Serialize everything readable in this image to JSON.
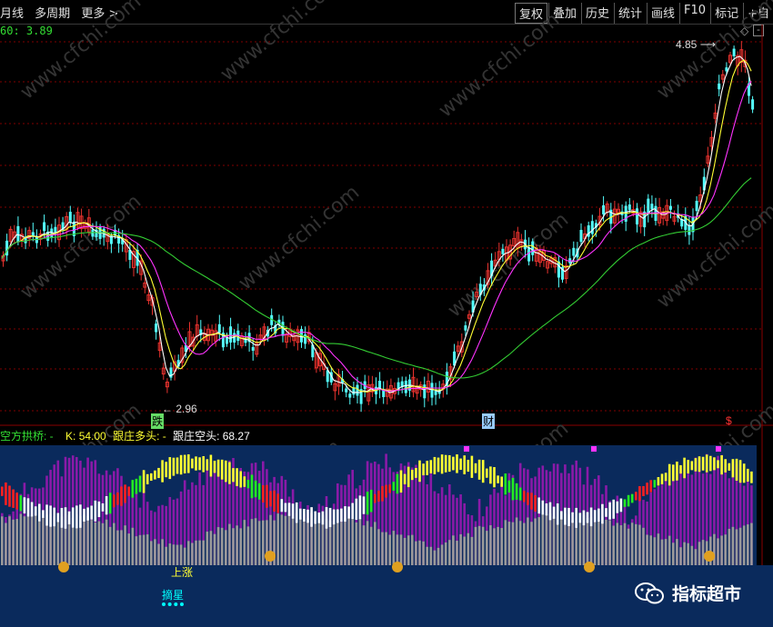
{
  "toolbar": {
    "left_items": [
      "月线",
      "多周期",
      "更多 >"
    ],
    "right_items": [
      "复权",
      "叠加",
      "历史",
      "统计",
      "画线",
      "F10",
      "标记",
      "+自"
    ]
  },
  "ma_readout": "60: 3.89",
  "price_labels": {
    "high": "4.85",
    "low": "2.96"
  },
  "chart_markers": {
    "die": "跌",
    "cai": "财",
    "dollar": "$"
  },
  "indicator": {
    "name": "空方拱桥: -",
    "k": "K: 54.00",
    "dz_long": "跟庄多头: -",
    "dz_short": "跟庄空头: 68.27"
  },
  "bottom_markers": {
    "shangzhang": "上涨",
    "zhaixing": "摘星"
  },
  "watermark": "www.cfchi.com",
  "wechat": {
    "title": "指标超市"
  },
  "colors": {
    "up": "#e8322e",
    "down": "#54ffff",
    "ma5": "#ffffff",
    "ma10": "#ffff33",
    "ma20": "#ff33ff",
    "ma60": "#33cc33",
    "indicator_bg": "#0a2a5c",
    "grid": "#800000"
  },
  "chart_data": [
    {
      "type": "candlestick",
      "title": "",
      "y_high_label": 4.85,
      "y_low_label": 2.96,
      "ma60_value": 3.89,
      "series": [
        {
          "name": "",
          "values": []
        }
      ]
    },
    {
      "type": "bar",
      "title": "空方拱桥",
      "values": {
        "K": 54.0,
        "跟庄空头": 68.27
      }
    }
  ]
}
